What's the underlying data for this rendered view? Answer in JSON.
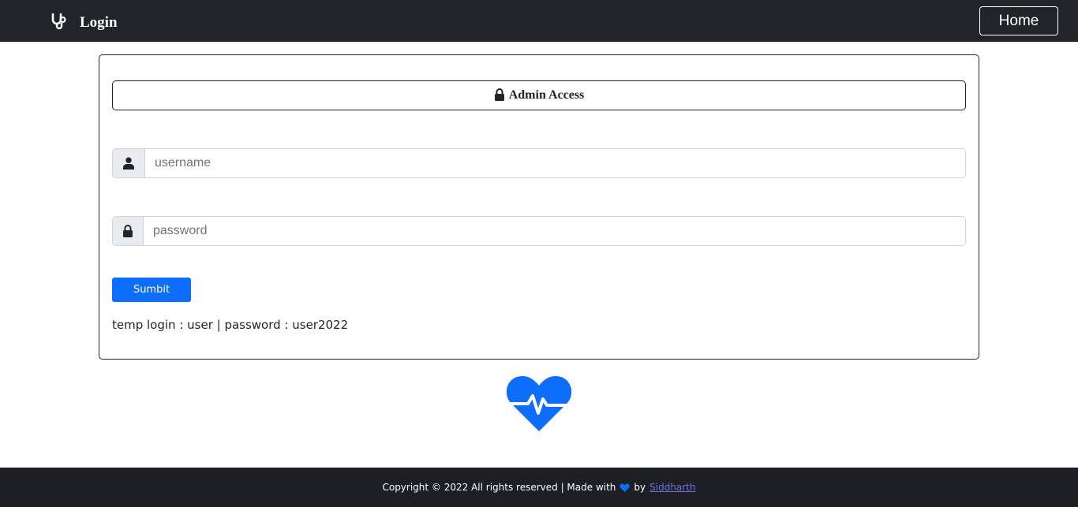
{
  "navbar": {
    "brand_icon": "stethoscope-icon",
    "title": "Login",
    "home_label": "Home"
  },
  "card": {
    "header_icon": "lock-icon",
    "header_title": "Admin Access",
    "username": {
      "icon": "user-icon",
      "placeholder": "username",
      "value": ""
    },
    "password": {
      "icon": "lock-icon",
      "placeholder": "password",
      "value": ""
    },
    "submit_label": "Sumbit",
    "temp_login_text": "temp login : user | password : user2022"
  },
  "heart_icon": "heartbeat-icon",
  "footer": {
    "text_before": "Copyright © 2022 All rights reserved | Made with",
    "heart_icon": "heart-icon",
    "text_by": "by",
    "author_link": "Siddharth"
  },
  "colors": {
    "navbar_bg": "#212529",
    "footer_bg": "#1c1f23",
    "accent": "#0d6efd",
    "link": "#6f6fe0"
  }
}
